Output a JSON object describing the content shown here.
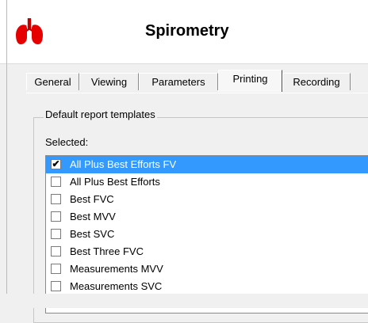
{
  "header": {
    "title": "Spirometry",
    "icon": "lungs-icon",
    "icon_color": "#e60000"
  },
  "tabs": [
    {
      "label": "General",
      "active": false
    },
    {
      "label": "Viewing",
      "active": false
    },
    {
      "label": "Parameters",
      "active": false
    },
    {
      "label": "Printing",
      "active": true
    },
    {
      "label": "Recording",
      "active": false
    }
  ],
  "group": {
    "legend": "Default report templates",
    "selected_label": "Selected:"
  },
  "templates": [
    {
      "label": "All Plus Best Efforts FV",
      "checked": true,
      "highlighted": true
    },
    {
      "label": "All Plus Best Efforts",
      "checked": false,
      "highlighted": false
    },
    {
      "label": "Best FVC",
      "checked": false,
      "highlighted": false
    },
    {
      "label": "Best MVV",
      "checked": false,
      "highlighted": false
    },
    {
      "label": "Best SVC",
      "checked": false,
      "highlighted": false
    },
    {
      "label": "Best Three FVC",
      "checked": false,
      "highlighted": false
    },
    {
      "label": "Measurements MVV",
      "checked": false,
      "highlighted": false
    },
    {
      "label": "Measurements SVC",
      "checked": false,
      "highlighted": false
    }
  ],
  "colors": {
    "selection": "#3399ff",
    "window_bg": "#f0f0f0"
  }
}
